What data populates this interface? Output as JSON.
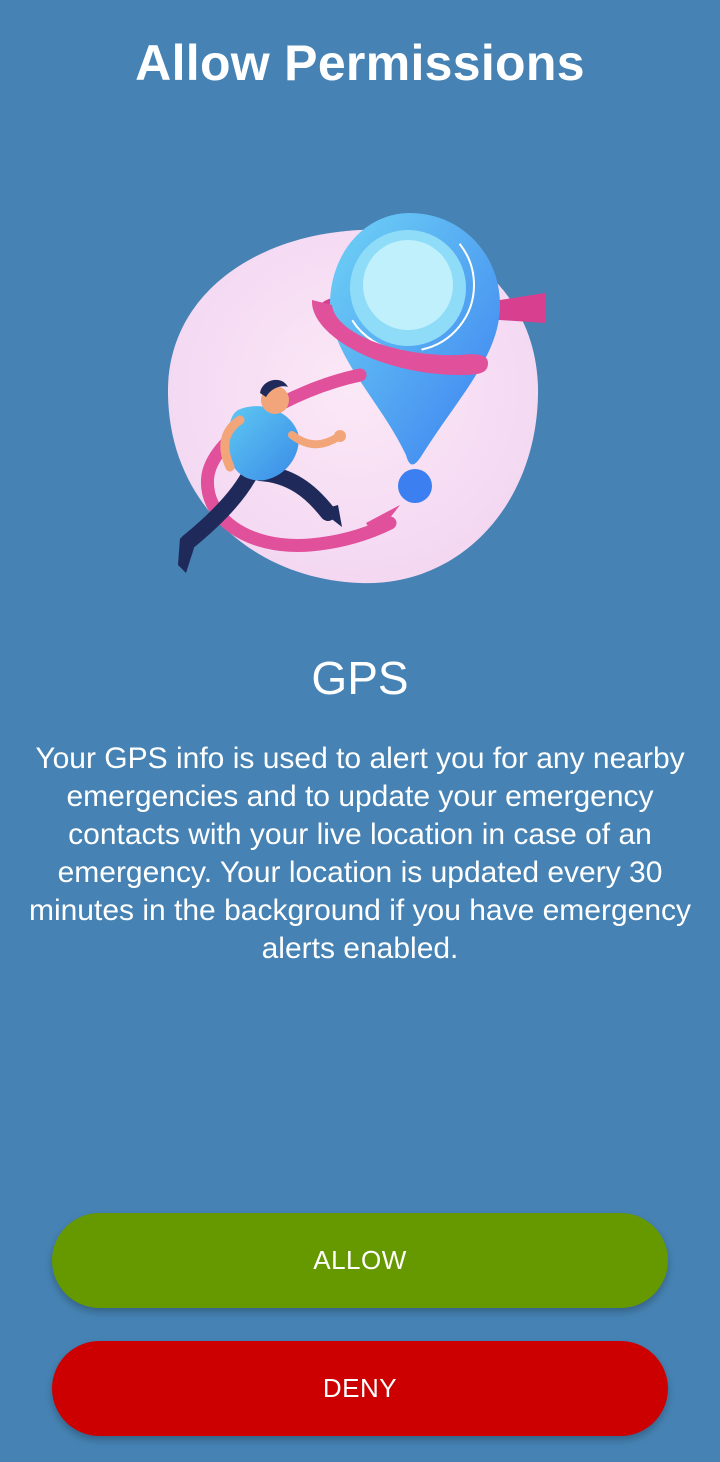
{
  "header": {
    "title": "Allow Permissions"
  },
  "illustration": {
    "icon": "gps-location-pin-runner-illustration"
  },
  "permission": {
    "title": "GPS",
    "description": "Your GPS info is used to alert you for any nearby emergencies and to update your emergency contacts with your live location in case of an emergency. Your location is updated every 30 minutes in the background if you have emergency alerts enabled."
  },
  "actions": {
    "allow_label": "ALLOW",
    "deny_label": "DENY"
  },
  "colors": {
    "background": "#4683b4",
    "allow": "#669900",
    "deny": "#cc0000"
  }
}
